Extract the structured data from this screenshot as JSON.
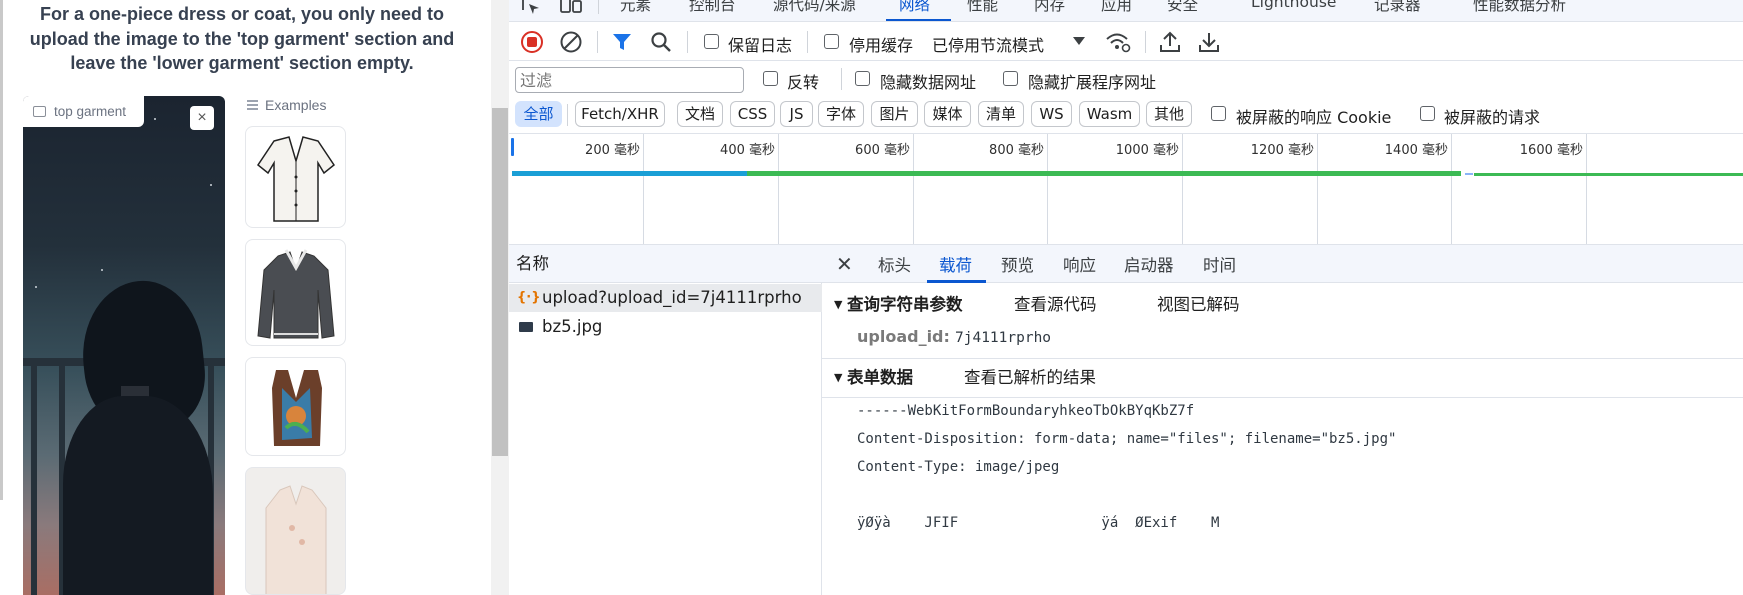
{
  "page": {
    "instructions": "For a one-piece dress or coat, you only need to upload the image to the 'top garment' section and leave the 'lower garment' section empty.",
    "top_garment_label": "top garment",
    "close_icon": "×",
    "examples_label": "Examples"
  },
  "devtools": {
    "tabs": [
      "元素",
      "控制台",
      "源代码/来源",
      "网络",
      "性能",
      "内存",
      "应用",
      "安全",
      "Lighthouse",
      "记录器",
      "性能数据分析"
    ],
    "active_tab": "网络",
    "toolbar": {
      "preserve_log": "保留日志",
      "disable_cache": "停用缓存",
      "throttling": "已停用节流模式"
    },
    "filter": {
      "placeholder": "过滤",
      "invert": "反转",
      "hide_data_urls": "隐藏数据网址",
      "hide_extension_urls": "隐藏扩展程序网址"
    },
    "type_filters": [
      "全部",
      "Fetch/XHR",
      "文档",
      "CSS",
      "JS",
      "字体",
      "图片",
      "媒体",
      "清单",
      "WS",
      "Wasm",
      "其他"
    ],
    "blocked_cookies": "被屏蔽的响应 Cookie",
    "blocked_requests": "被屏蔽的请求",
    "timeline_ticks": [
      "200 毫秒",
      "400 毫秒",
      "600 毫秒",
      "800 毫秒",
      "1000 毫秒",
      "1200 毫秒",
      "1400 毫秒",
      "1600 毫秒"
    ],
    "requests_header": "名称",
    "requests": [
      {
        "name": "upload?upload_id=7j4111rprho",
        "icon": "xhr-icon",
        "selected": true
      },
      {
        "name": "bz5.jpg",
        "icon": "image-icon",
        "selected": false
      }
    ],
    "detail_tabs": [
      "标头",
      "载荷",
      "预览",
      "响应",
      "启动器",
      "时间"
    ],
    "active_detail_tab": "载荷",
    "query_section": {
      "title": "查询字符串参数",
      "view_source": "查看源代码",
      "view_decoded": "视图已解码",
      "param_key": "upload_id:",
      "param_value": "7j4111rprho"
    },
    "form_section": {
      "title": "表单数据",
      "view_parsed": "查看已解析的结果",
      "lines": [
        "------WebKitFormBoundaryhkeoTbOkBYqKbZ7f",
        "Content-Disposition: form-data; name=\"files\"; filename=\"bz5.jpg\"",
        "Content-Type: image/jpeg",
        "",
        "ÿØÿà    JFIF                 ÿá  ØExif    M"
      ]
    },
    "colors": {
      "accent": "#0b57d0",
      "record_red": "#d93025",
      "timeline_blue": "#1a9fd6",
      "timeline_green": "#3cba54"
    }
  }
}
